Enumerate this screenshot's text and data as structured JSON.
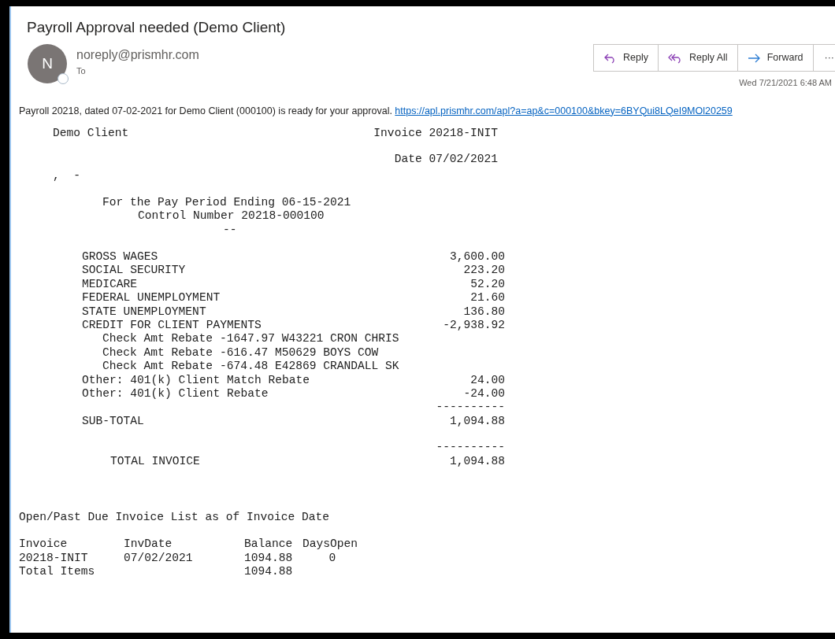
{
  "email": {
    "subject": "Payroll Approval needed (Demo Client)",
    "sender": {
      "initial": "N",
      "address": "noreply@prismhr.com",
      "to_label": "To"
    },
    "actions": [
      {
        "kind": "reply",
        "label": "Reply"
      },
      {
        "kind": "reply_all",
        "label": "Reply All"
      },
      {
        "kind": "forward",
        "label": "Forward"
      },
      {
        "kind": "more",
        "label": "···"
      }
    ],
    "timestamp": "Wed 7/21/2021 6:48 AM",
    "intro": "Payroll 20218, dated 07-02-2021 for Demo Client (000100) is ready for your approval.",
    "link": "https://apl.prismhr.com/apl?a=ap&c=000100&bkey=6BYQui8LQeI9MOl20259"
  },
  "invoice": {
    "client": "Demo Client",
    "invoice_no": "Invoice 20218-INIT",
    "date": "Date 07/02/2021",
    "address_line": ",  -",
    "heading_lines": [
      {
        "kind": "period",
        "text": "For the Pay Period Ending 06-15-2021"
      },
      {
        "kind": "control",
        "text": "Control Number 20218-000100"
      },
      {
        "kind": "dashes",
        "text": "--"
      }
    ],
    "rows": [
      {
        "kind": "item",
        "label": "GROSS WAGES",
        "amount": "3,600.00"
      },
      {
        "kind": "item",
        "label": "SOCIAL SECURITY",
        "amount": "223.20"
      },
      {
        "kind": "item",
        "label": "MEDICARE",
        "amount": "52.20"
      },
      {
        "kind": "item",
        "label": "FEDERAL UNEMPLOYMENT",
        "amount": "21.60"
      },
      {
        "kind": "item",
        "label": "STATE UNEMPLOYMENT",
        "amount": "136.80"
      },
      {
        "kind": "item",
        "label": "CREDIT FOR CLIENT PAYMENTS",
        "amount": "-2,938.92"
      },
      {
        "kind": "detail",
        "label": "Check Amt Rebate -1647.97 W43221 CRON CHRIS"
      },
      {
        "kind": "detail",
        "label": "Check Amt Rebate -616.47 M50629 BOYS COW"
      },
      {
        "kind": "detail",
        "label": "Check Amt Rebate -674.48 E42869 CRANDALL SK"
      },
      {
        "kind": "item",
        "label": "Other: 401(k) Client Match Rebate",
        "amount": "24.00"
      },
      {
        "kind": "item",
        "label": "Other: 401(k) Client Rebate",
        "amount": "-24.00"
      },
      {
        "kind": "rule",
        "amount": "----------"
      },
      {
        "kind": "subtotal",
        "label": "SUB-TOTAL",
        "amount": "1,094.88"
      },
      {
        "kind": "rule",
        "amount": "----------"
      },
      {
        "kind": "total",
        "label": "TOTAL INVOICE",
        "amount": "1,094.88"
      }
    ]
  },
  "open_list": {
    "title": "Open/Past Due Invoice List as of Invoice Date",
    "columns": [
      "Invoice",
      "InvDate",
      "Balance",
      "DaysOpen"
    ],
    "rows": [
      {
        "invoice": "20218-INIT",
        "inv_date": "07/02/2021",
        "balance": "1094.88",
        "days_open": "0"
      },
      {
        "invoice": "Total Items",
        "balance": "1094.88"
      }
    ]
  }
}
